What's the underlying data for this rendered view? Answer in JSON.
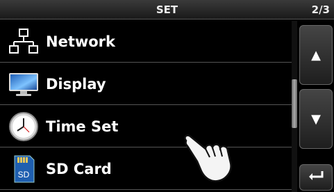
{
  "header": {
    "title": "SET",
    "page_indicator": "2/3"
  },
  "menu": {
    "items": [
      {
        "label": "Network",
        "icon": "network-icon"
      },
      {
        "label": "Display",
        "icon": "display-icon"
      },
      {
        "label": "Time Set",
        "icon": "clock-icon"
      },
      {
        "label": "SD Card",
        "icon": "sd-card-icon",
        "icon_text": "SD"
      }
    ]
  },
  "side_buttons": {
    "up": "▲",
    "down": "▼",
    "back": "return-icon"
  },
  "overlay": {
    "hand": "touch-hand-icon"
  }
}
